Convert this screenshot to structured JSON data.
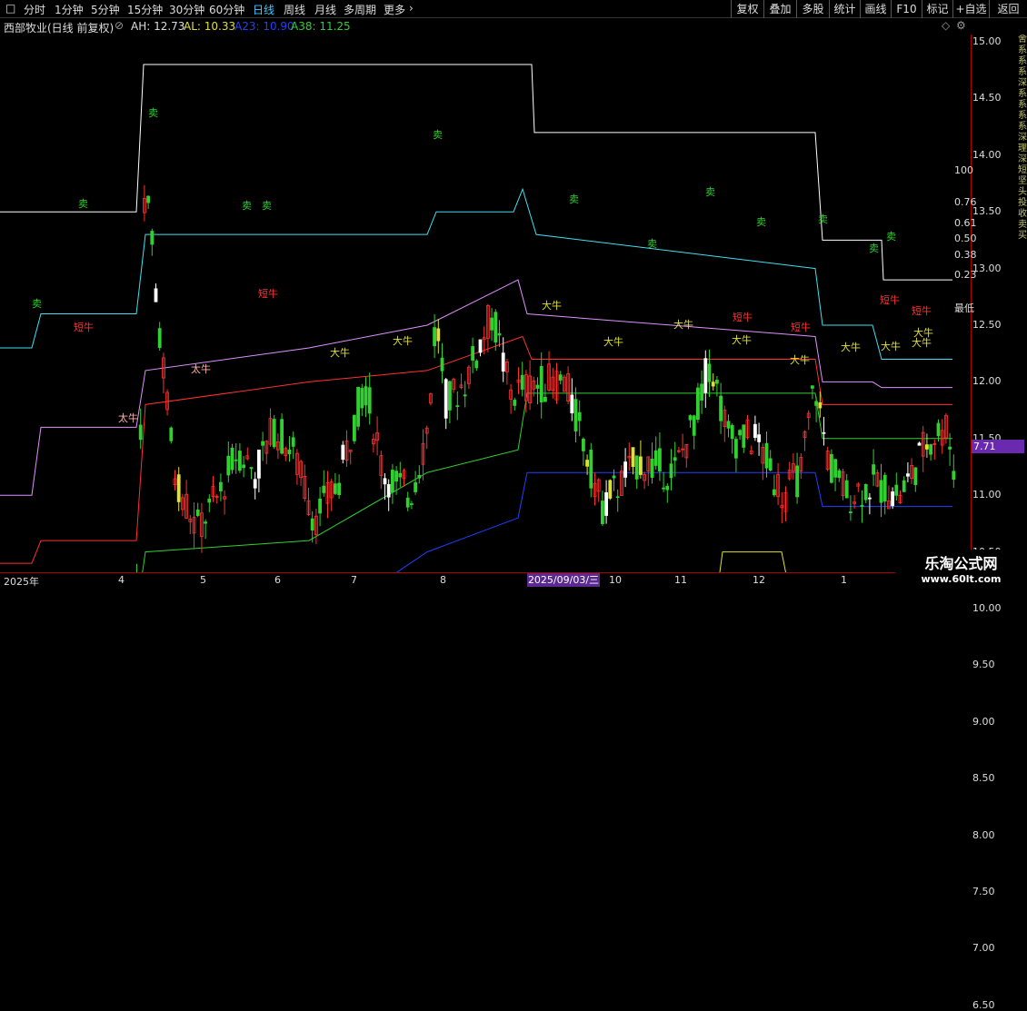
{
  "toolbar": {
    "items": [
      "分时",
      "1分钟",
      "5分钟",
      "15分钟",
      "30分钟",
      "60分钟",
      "日线",
      "周线",
      "月线",
      "多周期",
      "更多"
    ],
    "active": "日线",
    "right": [
      "复权",
      "叠加",
      "多股",
      "统计",
      "画线",
      "F10",
      "标记",
      "+自选",
      "返回"
    ]
  },
  "title": {
    "name": "西部牧业(日线 前复权)",
    "ah": "AH: 12.73",
    "al": "AL: 10.33",
    "a23": "A23: 10.90",
    "a38": "A38: 11.25"
  },
  "yaxis": [
    "15.00",
    "14.50",
    "14.00",
    "13.50",
    "13.00",
    "12.50",
    "12.00",
    "11.50",
    "11.00",
    "10.50",
    "10.00",
    "9.50",
    "9.00",
    "8.50",
    "8.00",
    "7.50",
    "7.00",
    "6.50"
  ],
  "xaxis": [
    "2025年",
    "4",
    "5",
    "6",
    "7",
    "8",
    "10",
    "11",
    "12",
    "1"
  ],
  "date_tag": "2025/09/03/三",
  "price_tag": "7.71",
  "levels": [
    "100",
    "0.76",
    "0.61",
    "0.50",
    "0.38",
    "0.23",
    "最低"
  ],
  "labels": {
    "sell": "卖",
    "short": "短牛",
    "big": "大牛",
    "tai": "太牛"
  },
  "watermark": {
    "line1": "乐淘公式网",
    "line2": "www.60lt.com"
  },
  "side_text": "舍系系系深系系系系深理深短坚头投收卖买",
  "colors": {
    "up": "#ff3030",
    "down": "#00d0d0",
    "green": "#30d030",
    "yellow": "#e0e030",
    "white": "#ffffff",
    "cyan": "#40e0f0",
    "violet": "#e090ff",
    "blue": "#2040ff"
  },
  "chart_data": {
    "type": "candlestick",
    "ylim": [
      6.3,
      15.2
    ],
    "last": 11.25
  }
}
